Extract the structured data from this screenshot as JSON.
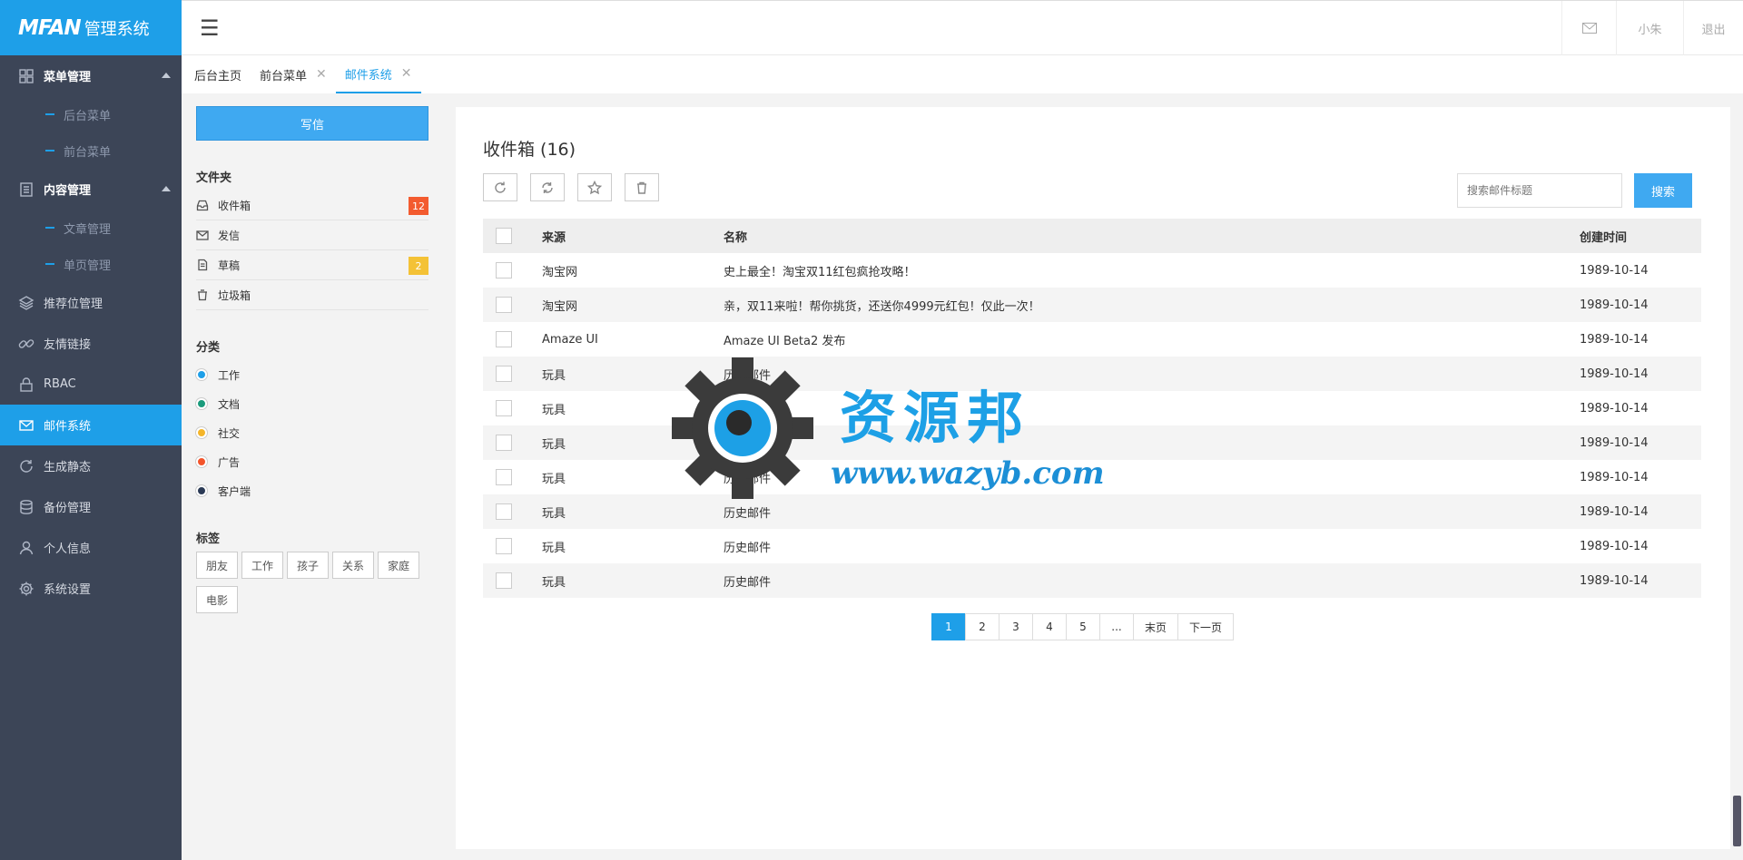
{
  "brand": {
    "logo": "MFAN",
    "title": "管理系统"
  },
  "sidebar": {
    "items": [
      {
        "label": "菜单管理",
        "icon": "grid-icon",
        "type": "parent",
        "children": [
          "后台菜单",
          "前台菜单"
        ]
      },
      {
        "label": "内容管理",
        "icon": "document-icon",
        "type": "parent",
        "children": [
          "文章管理",
          "单页管理"
        ]
      },
      {
        "label": "推荐位管理",
        "icon": "layers-icon"
      },
      {
        "label": "友情链接",
        "icon": "link-icon"
      },
      {
        "label": "RBAC",
        "icon": "lock-icon"
      },
      {
        "label": "邮件系统",
        "icon": "mail-icon",
        "active": true
      },
      {
        "label": "生成静态",
        "icon": "refresh-icon"
      },
      {
        "label": "备份管理",
        "icon": "database-icon"
      },
      {
        "label": "个人信息",
        "icon": "user-icon"
      },
      {
        "label": "系统设置",
        "icon": "gear-icon"
      }
    ]
  },
  "topbar": {
    "user": "小朱",
    "logout": "退出"
  },
  "tabs": [
    {
      "label": "后台主页"
    },
    {
      "label": "前台菜单"
    },
    {
      "label": "邮件系统",
      "active": true
    }
  ],
  "leftpanel": {
    "write_label": "写信",
    "folders_title": "文件夹",
    "folders": [
      {
        "label": "收件箱",
        "badge": "12",
        "badge_color": "#f35b2f"
      },
      {
        "label": "发信"
      },
      {
        "label": "草稿",
        "badge": "2",
        "badge_color": "#f4c236"
      },
      {
        "label": "垃圾箱"
      }
    ],
    "categories_title": "分类",
    "categories": [
      {
        "label": "工作",
        "color": "#1e9fe8"
      },
      {
        "label": "文档",
        "color": "#1a9b7c"
      },
      {
        "label": "社交",
        "color": "#f4b52a"
      },
      {
        "label": "广告",
        "color": "#f3542b"
      },
      {
        "label": "客户端",
        "color": "#2b3a55"
      }
    ],
    "tags_title": "标签",
    "tags": [
      "朋友",
      "工作",
      "孩子",
      "关系",
      "家庭",
      "电影"
    ]
  },
  "main": {
    "title": "收件箱 (16)",
    "search_placeholder": "搜索邮件标题",
    "search_label": "搜索",
    "columns": [
      "来源",
      "名称",
      "创建时间"
    ],
    "rows": [
      {
        "source": "淘宝网",
        "name": "史上最全！淘宝双11红包疯抢攻略！",
        "date": "1989-10-14"
      },
      {
        "source": "淘宝网",
        "name": "亲，双11来啦！帮你挑货，还送你4999元红包！仅此一次！",
        "date": "1989-10-14"
      },
      {
        "source": "Amaze UI",
        "name": "Amaze UI Beta2 发布",
        "date": "1989-10-14"
      },
      {
        "source": "玩具",
        "name": "历史邮件",
        "date": "1989-10-14"
      },
      {
        "source": "玩具",
        "name": "历史邮件",
        "date": "1989-10-14"
      },
      {
        "source": "玩具",
        "name": "历史邮件",
        "date": "1989-10-14"
      },
      {
        "source": "玩具",
        "name": "历史邮件",
        "date": "1989-10-14"
      },
      {
        "source": "玩具",
        "name": "历史邮件",
        "date": "1989-10-14"
      },
      {
        "source": "玩具",
        "name": "历史邮件",
        "date": "1989-10-14"
      },
      {
        "source": "玩具",
        "name": "历史邮件",
        "date": "1989-10-14"
      }
    ],
    "pagination": [
      "1",
      "2",
      "3",
      "4",
      "5",
      "...",
      "末页",
      "下一页"
    ],
    "current_page": "1"
  },
  "watermark": {
    "text": "资源邦",
    "url": "www.wazyb.com"
  }
}
